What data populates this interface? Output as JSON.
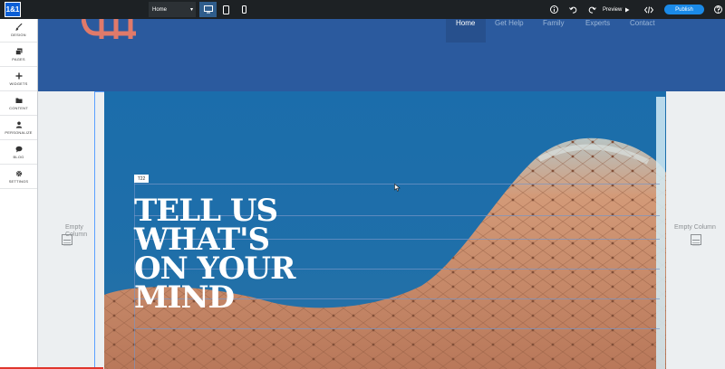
{
  "app": {
    "logo_text": "1&1"
  },
  "toolbar": {
    "page_select_value": "Home",
    "preview_label": "Preview",
    "publish_label": "Publish",
    "icons": [
      "desktop-icon",
      "tablet-icon",
      "mobile-icon",
      "info-icon",
      "undo-icon",
      "redo-icon",
      "play-icon",
      "code-icon",
      "help-icon"
    ]
  },
  "sidebar": {
    "items": [
      {
        "label": "DESIGN",
        "icon": "brush-icon"
      },
      {
        "label": "PAGES",
        "icon": "pages-icon"
      },
      {
        "label": "WIDGETS",
        "icon": "plus-icon"
      },
      {
        "label": "CONTENT",
        "icon": "folder-icon"
      },
      {
        "label": "PERSONALIZE",
        "icon": "user-icon"
      },
      {
        "label": "BLOG",
        "icon": "speech-bubble-icon"
      },
      {
        "label": "SETTINGS",
        "icon": "gear-icon"
      }
    ]
  },
  "site": {
    "nav": [
      "Home",
      "Get Help",
      "Family",
      "Experts",
      "Contact"
    ],
    "active_nav": "Home",
    "headline_lines": [
      "TELL US",
      "WHAT'S",
      "ON YOUR",
      "MIND"
    ],
    "element_tag": "T22",
    "left_column_label": "Empty Column",
    "right_column_label": "Empty Column"
  },
  "colors": {
    "toolbar_bg": "#1d2124",
    "header_bg": "#2b5a9e",
    "hero_bg": "#1b6dab",
    "publish": "#1a8ae8",
    "logo_mark": "#e07a6a",
    "leather": "#c98b6a"
  }
}
